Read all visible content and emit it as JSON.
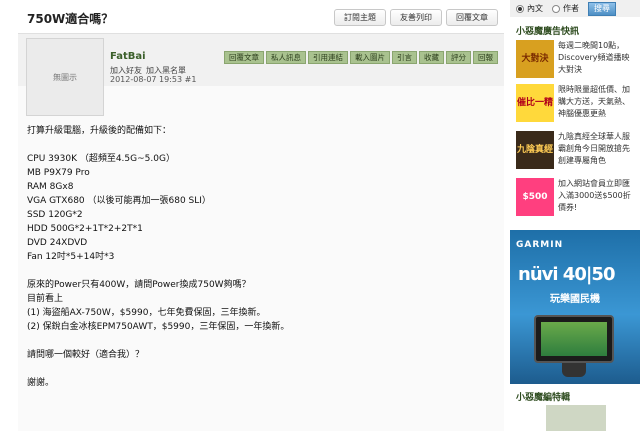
{
  "thread": {
    "title": "750W適合嗎？",
    "actions": [
      "訂閱主題",
      "友善列印",
      "回覆文章"
    ]
  },
  "post": {
    "avatar_text": "無圖示",
    "username": "FatBai",
    "user_links": [
      "加入好友",
      "加入黑名單"
    ],
    "meta": "2012-08-07 19:53 #1",
    "actions": [
      "回覆文章",
      "私人訊息",
      "引用連結",
      "載入圖片",
      "引言",
      "收藏",
      "評分",
      "回報"
    ],
    "content": [
      "打算升級電腦，升級後的配備如下：",
      "",
      "CPU 3930K （超頻至4.5G~5.0G）",
      "MB P9X79 Pro",
      "RAM 8Gx8",
      "VGA GTX680 （以後可能再加一張680 SLI）",
      "SSD 120G*2",
      "HDD 500G*2+1T*2+2T*1",
      "DVD 24XDVD",
      "Fan 12吋*5+14吋*3",
      "",
      "原來的Power只有400W，請問Power換成750W夠嗎？",
      "目前看上",
      "(1) 海盜船AX-750W，$5990，七年免費保固，三年換新。",
      "(2) 保銳白金冰核EPM750AWT，$5990，三年保固，一年換新。",
      "",
      "請問哪一個較好（適合我）？",
      "",
      "謝謝。"
    ]
  },
  "sidebar": {
    "search": {
      "option_content": "內文",
      "option_author": "作者",
      "button": "搜尋"
    },
    "ads_title": "小惡魔廣告快訊",
    "ads": [
      {
        "thumb": "大對決",
        "text": "每週二晚間10點，Discovery頻道播映大對決",
        "bg": "#d8a020",
        "fg": "#7a2a00"
      },
      {
        "thumb": "催比一精",
        "text": "限時限量超低價、加購大方送，天氣熱、神腦優惠更熱",
        "bg": "#ffd93b",
        "fg": "#b0001a"
      },
      {
        "thumb": "九陰真經",
        "text": "九陰真經全球華人服霸創角今日開放搶先創建專屬角色",
        "bg": "#3a2a1a",
        "fg": "#ffcc55"
      },
      {
        "thumb": "$500",
        "text": "加入網站會員立即匯入滿3000送$500折價券!",
        "bg": "#ff3f7f",
        "fg": "#ffffff"
      }
    ],
    "banner": {
      "brand": "GARMIN",
      "model": "nüvi 40|50",
      "tagline": "玩樂國民機"
    },
    "features_title": "小惡魔編特輯"
  }
}
